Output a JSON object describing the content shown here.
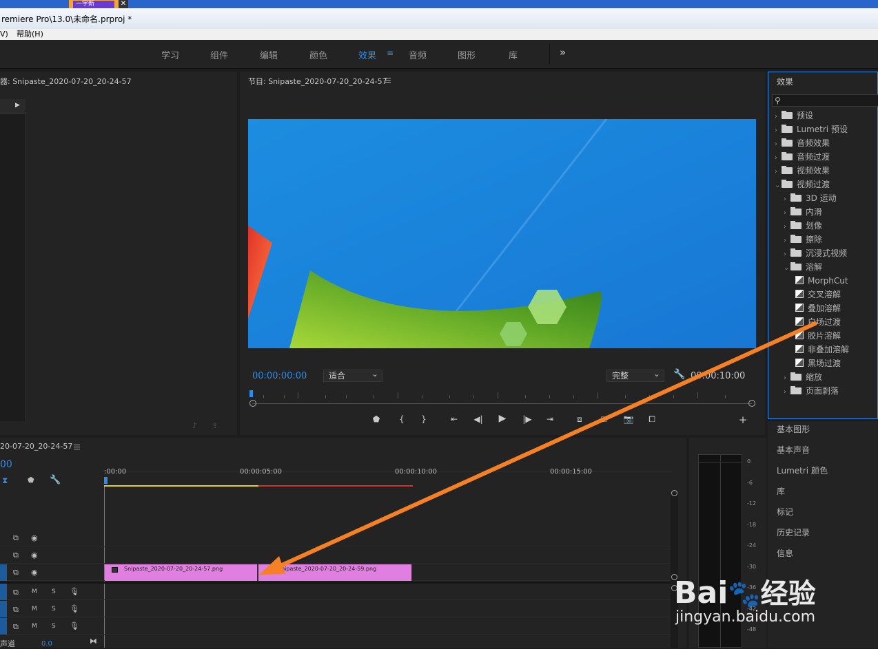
{
  "window": {
    "title": "remiere Pro\\13.0\\未命名.prproj *",
    "tab_label": "一宇新"
  },
  "menu": [
    "V)",
    "帮助(H)"
  ],
  "workspaces": [
    {
      "label": "学习",
      "active": false
    },
    {
      "label": "组件",
      "active": false
    },
    {
      "label": "编辑",
      "active": false
    },
    {
      "label": "颜色",
      "active": false
    },
    {
      "label": "效果",
      "active": true
    },
    {
      "label": "音频",
      "active": false
    },
    {
      "label": "图形",
      "active": false
    },
    {
      "label": "库",
      "active": false
    }
  ],
  "more_label": "»",
  "source": {
    "title": "器: Snipaste_2020-07-20_20-24-57"
  },
  "program": {
    "title": "节目: Snipaste_2020-07-20_20-24-57",
    "timecode_in": "00:00:00:00",
    "fit_dropdown": "适合",
    "quality_dropdown": "完整",
    "timecode_out": "00:00:10:00"
  },
  "effects": {
    "title": "效果",
    "search_icon": "⚲",
    "tree": [
      {
        "label": "预设",
        "level": 0,
        "kind": "preset-folder",
        "expanded": false
      },
      {
        "label": "Lumetri 预设",
        "level": 0,
        "kind": "preset-folder",
        "expanded": false
      },
      {
        "label": "音频效果",
        "level": 0,
        "kind": "folder",
        "expanded": false
      },
      {
        "label": "音频过渡",
        "level": 0,
        "kind": "folder",
        "expanded": false
      },
      {
        "label": "视频效果",
        "level": 0,
        "kind": "folder",
        "expanded": false
      },
      {
        "label": "视频过渡",
        "level": 0,
        "kind": "folder",
        "expanded": true
      },
      {
        "label": "3D 运动",
        "level": 1,
        "kind": "folder",
        "expanded": false
      },
      {
        "label": "内滑",
        "level": 1,
        "kind": "folder",
        "expanded": false
      },
      {
        "label": "划像",
        "level": 1,
        "kind": "folder",
        "expanded": false
      },
      {
        "label": "擦除",
        "level": 1,
        "kind": "folder",
        "expanded": false
      },
      {
        "label": "沉浸式视频",
        "level": 1,
        "kind": "folder",
        "expanded": false
      },
      {
        "label": "溶解",
        "level": 1,
        "kind": "folder",
        "expanded": true
      },
      {
        "label": "MorphCut",
        "level": 2,
        "kind": "effect"
      },
      {
        "label": "交叉溶解",
        "level": 2,
        "kind": "effect"
      },
      {
        "label": "叠加溶解",
        "level": 2,
        "kind": "effect"
      },
      {
        "label": "白场过渡",
        "level": 2,
        "kind": "effect"
      },
      {
        "label": "胶片溶解",
        "level": 2,
        "kind": "effect"
      },
      {
        "label": "非叠加溶解",
        "level": 2,
        "kind": "effect"
      },
      {
        "label": "黑场过渡",
        "level": 2,
        "kind": "effect"
      },
      {
        "label": "缩放",
        "level": 1,
        "kind": "folder",
        "expanded": false
      },
      {
        "label": "页面剥落",
        "level": 1,
        "kind": "folder",
        "expanded": false
      }
    ]
  },
  "side_panels": [
    "基本图形",
    "基本声音",
    "Lumetri 颜色",
    "库",
    "标记",
    "历史记录",
    "信息"
  ],
  "timeline": {
    "title": "20-07-20_20-24-57",
    "timecode": "00",
    "ruler": [
      ":00:00",
      "00:00:05:00",
      "00:00:10:00",
      "00:00:15:00"
    ],
    "clips": [
      "Snipaste_2020-07-20_20-24-57.png",
      "Snipaste_2020-07-20_20-24-59.png"
    ],
    "track_m": "M",
    "track_s": "S",
    "bottom_label": "声道",
    "bottom_value": "0.0"
  },
  "meter": {
    "labels": [
      "0",
      "-6",
      "-12",
      "-18",
      "-24",
      "-30",
      "-36",
      "-42",
      "-48"
    ]
  },
  "watermark": {
    "brand": "Bai",
    "brand_cn": "经验",
    "url": "jingyan.baidu.com"
  },
  "colors": {
    "accent": "#2d8ceb",
    "clip": "#e07fe0",
    "arrow": "#f58025",
    "work_area": "#e2d12a",
    "render_red": "#d3302a"
  }
}
